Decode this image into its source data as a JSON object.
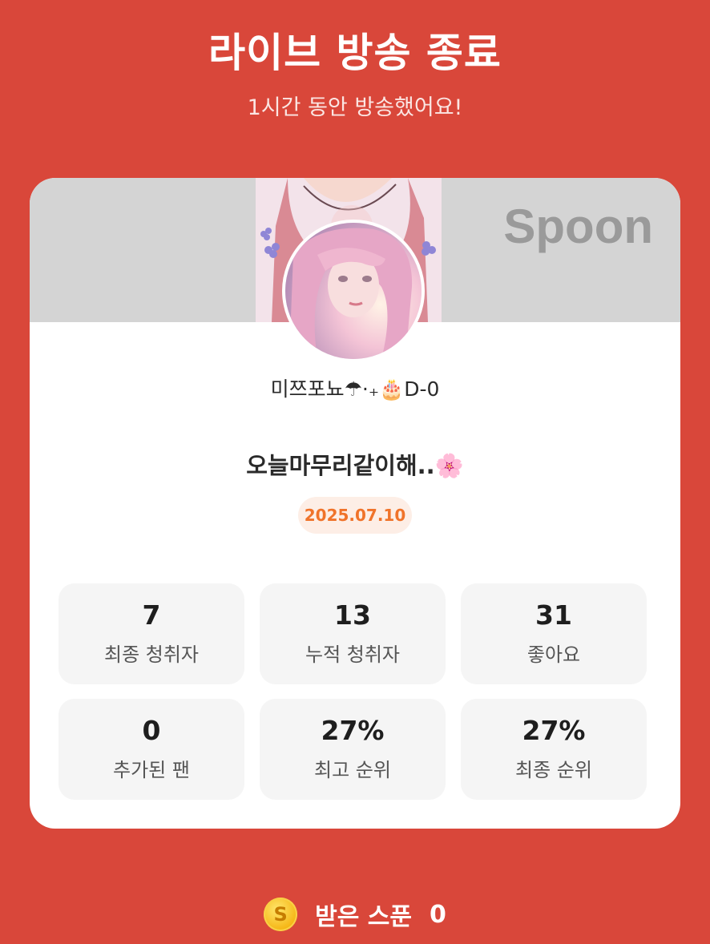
{
  "header": {
    "title": "라이브 방송 종료",
    "subtitle": "1시간 동안 방송했어요!"
  },
  "card": {
    "logo_text": "Spoon",
    "nickname": "미쯔포뇨☂︎⋅₊🎂D-0",
    "live_title": "오늘마무리같이해..🌸",
    "date": "2025.07.10"
  },
  "stats": [
    {
      "value": "7",
      "label": "최종 청취자"
    },
    {
      "value": "13",
      "label": "누적 청취자"
    },
    {
      "value": "31",
      "label": "좋아요"
    },
    {
      "value": "0",
      "label": "추가된 팬"
    },
    {
      "value": "27%",
      "label": "최고 순위"
    },
    {
      "value": "27%",
      "label": "최종 순위"
    }
  ],
  "footer": {
    "coin_icon": "spoon-coin-icon",
    "coin_symbol": "S",
    "label": "받은 스푼",
    "value": "0"
  },
  "colors": {
    "background": "#d9473a",
    "date_accent": "#f0732a",
    "date_pill_bg": "#fdeee6",
    "stat_bg": "#f5f5f5"
  }
}
